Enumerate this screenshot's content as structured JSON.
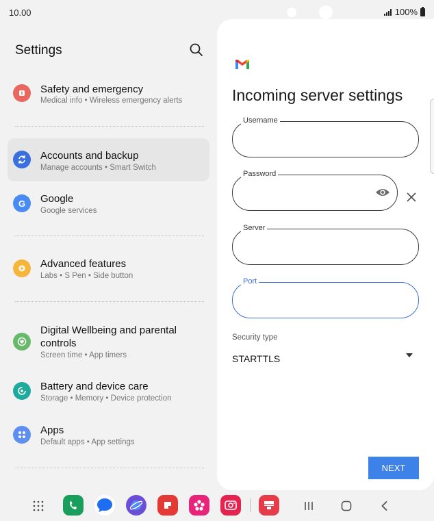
{
  "status": {
    "time": "10.00",
    "battery": "100%"
  },
  "settings": {
    "title": "Settings",
    "items": [
      {
        "title": "Safety and emergency",
        "sub": "Medical info  •  Wireless emergency alerts",
        "color": "#e8685f",
        "icon": "alert-icon"
      },
      {
        "title": "Accounts and backup",
        "sub": "Manage accounts  •  Smart Switch",
        "color": "#3a6fe0",
        "icon": "sync-icon"
      },
      {
        "title": "Google",
        "sub": "Google services",
        "color": "#4a8af4",
        "icon": "google-g-icon",
        "glyph": "G"
      },
      {
        "title": "Advanced features",
        "sub": "Labs  •  S Pen  •  Side button",
        "color": "#f5b63b",
        "icon": "gear-plus-icon"
      },
      {
        "title": "Digital Wellbeing and parental controls",
        "sub": "Screen time  •  App timers",
        "color": "#68b96b",
        "icon": "heart-circle-icon"
      },
      {
        "title": "Battery and device care",
        "sub": "Storage  •  Memory  •  Device protection",
        "color": "#1faa9d",
        "icon": "care-icon"
      },
      {
        "title": "Apps",
        "sub": "Default apps  •  App settings",
        "color": "#5f8ff0",
        "icon": "apps-grid-icon"
      }
    ]
  },
  "server": {
    "title": "Incoming server settings",
    "username_label": "Username",
    "password_label": "Password",
    "server_label": "Server",
    "port_label": "Port",
    "security_label": "Security type",
    "security_value": "STARTTLS",
    "next_label": "NEXT"
  },
  "colors": {
    "accent": "#3e6fd8",
    "next": "#3d82e8",
    "selected": "#e6e6e6"
  }
}
